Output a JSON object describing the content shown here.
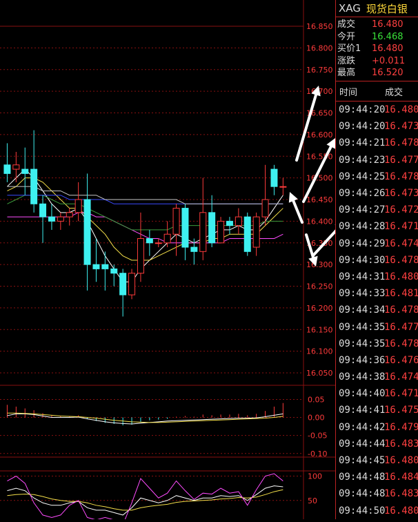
{
  "price_axis": {
    "ticks": [
      "16.850",
      "16.800",
      "16.750",
      "16.700",
      "16.650",
      "16.600",
      "16.550",
      "16.500",
      "16.450",
      "16.400",
      "16.350",
      "16.300",
      "16.250",
      "16.200",
      "16.150",
      "16.100",
      "16.050"
    ],
    "min": 16.05,
    "max": 16.85
  },
  "macd_axis": {
    "ticks": [
      "0.05",
      "0.00",
      "-0.05",
      "-0.10"
    ]
  },
  "kdj_axis": {
    "ticks": [
      "100",
      "50"
    ]
  },
  "colors": {
    "up": "#ff3b3b",
    "down": "#3ef0f0",
    "grid": "#8a1010",
    "ma1": "#ffffff",
    "ma2": "#f5e04a",
    "ma3": "#ff4cff",
    "ma4": "#3c9b3c",
    "ma5": "#3b4bff",
    "ma6": "#c8c8c8"
  },
  "header": {
    "code": "XAG",
    "name": "现货白银"
  },
  "quote": [
    {
      "label": "成交",
      "value": "16.480",
      "color": "red"
    },
    {
      "label": "今开",
      "value": "16.468",
      "color": "green"
    },
    {
      "label": "买价1",
      "value": "16.480",
      "color": "red"
    },
    {
      "label": "涨跌",
      "value": "+0.011",
      "color": "red"
    },
    {
      "label": "最高",
      "value": "16.520",
      "color": "red"
    }
  ],
  "trades_header": {
    "time": "时间",
    "price": "成交"
  },
  "trades": [
    {
      "time": "09:44:20",
      "price": "16.480"
    },
    {
      "time": "09:44:20",
      "price": "16.473"
    },
    {
      "time": "09:44:21",
      "price": "16.478"
    },
    {
      "time": "09:44:23",
      "price": "16.477"
    },
    {
      "time": "09:44:25",
      "price": "16.478"
    },
    {
      "time": "09:44:26",
      "price": "16.473"
    },
    {
      "time": "09:44:27",
      "price": "16.472"
    },
    {
      "time": "09:44:28",
      "price": "16.471"
    },
    {
      "time": "09:44:29",
      "price": "16.474"
    },
    {
      "time": "09:44:30",
      "price": "16.478"
    },
    {
      "time": "09:44:31",
      "price": "16.480"
    },
    {
      "time": "09:44:33",
      "price": "16.481"
    },
    {
      "time": "09:44:34",
      "price": "16.478"
    },
    {
      "time": "09:44:35",
      "price": "16.477"
    },
    {
      "time": "09:44:35",
      "price": "16.478"
    },
    {
      "time": "09:44:36",
      "price": "16.476"
    },
    {
      "time": "09:44:38",
      "price": "16.474"
    },
    {
      "time": "09:44:40",
      "price": "16.471"
    },
    {
      "time": "09:44:41",
      "price": "16.475"
    },
    {
      "time": "09:44:42",
      "price": "16.479"
    },
    {
      "time": "09:44:44",
      "price": "16.483"
    },
    {
      "time": "09:44:45",
      "price": "16.480"
    },
    {
      "time": "09:44:48",
      "price": "16.484"
    },
    {
      "time": "09:44:48",
      "price": "16.483"
    },
    {
      "time": "09:44:50",
      "price": "16.480"
    }
  ],
  "chart_data": {
    "type": "candlestick",
    "title": "",
    "ylim": [
      16.05,
      16.85
    ],
    "candles": [
      {
        "o": 16.53,
        "c": 16.51,
        "h": 16.58,
        "l": 16.49
      },
      {
        "o": 16.52,
        "c": 16.53,
        "h": 16.56,
        "l": 16.49
      },
      {
        "o": 16.52,
        "c": 16.51,
        "h": 16.57,
        "l": 16.46
      },
      {
        "o": 16.52,
        "c": 16.44,
        "h": 16.61,
        "l": 16.42
      },
      {
        "o": 16.44,
        "c": 16.41,
        "h": 16.46,
        "l": 16.35
      },
      {
        "o": 16.41,
        "c": 16.4,
        "h": 16.44,
        "l": 16.38
      },
      {
        "o": 16.4,
        "c": 16.41,
        "h": 16.42,
        "l": 16.38
      },
      {
        "o": 16.41,
        "c": 16.42,
        "h": 16.43,
        "l": 16.39
      },
      {
        "o": 16.42,
        "c": 16.45,
        "h": 16.49,
        "l": 16.4
      },
      {
        "o": 16.45,
        "c": 16.3,
        "h": 16.51,
        "l": 16.24
      },
      {
        "o": 16.3,
        "c": 16.29,
        "h": 16.36,
        "l": 16.26
      },
      {
        "o": 16.3,
        "c": 16.29,
        "h": 16.33,
        "l": 16.24
      },
      {
        "o": 16.29,
        "c": 16.28,
        "h": 16.3,
        "l": 16.25
      },
      {
        "o": 16.28,
        "c": 16.23,
        "h": 16.29,
        "l": 16.18
      },
      {
        "o": 16.23,
        "c": 16.28,
        "h": 16.29,
        "l": 16.22
      },
      {
        "o": 16.28,
        "c": 16.36,
        "h": 16.42,
        "l": 16.26
      },
      {
        "o": 16.36,
        "c": 16.35,
        "h": 16.38,
        "l": 16.32
      },
      {
        "o": 16.35,
        "c": 16.35,
        "h": 16.36,
        "l": 16.34
      },
      {
        "o": 16.35,
        "c": 16.37,
        "h": 16.4,
        "l": 16.34
      },
      {
        "o": 16.37,
        "c": 16.43,
        "h": 16.44,
        "l": 16.32
      },
      {
        "o": 16.43,
        "c": 16.34,
        "h": 16.44,
        "l": 16.31
      },
      {
        "o": 16.34,
        "c": 16.33,
        "h": 16.36,
        "l": 16.3
      },
      {
        "o": 16.33,
        "c": 16.42,
        "h": 16.5,
        "l": 16.31
      },
      {
        "o": 16.42,
        "c": 16.35,
        "h": 16.46,
        "l": 16.34
      },
      {
        "o": 16.35,
        "c": 16.4,
        "h": 16.41,
        "l": 16.35
      },
      {
        "o": 16.4,
        "c": 16.39,
        "h": 16.41,
        "l": 16.37
      },
      {
        "o": 16.39,
        "c": 16.41,
        "h": 16.43,
        "l": 16.37
      },
      {
        "o": 16.41,
        "c": 16.33,
        "h": 16.42,
        "l": 16.32
      },
      {
        "o": 16.34,
        "c": 16.41,
        "h": 16.42,
        "l": 16.32
      },
      {
        "o": 16.41,
        "c": 16.45,
        "h": 16.53,
        "l": 16.39
      },
      {
        "o": 16.52,
        "c": 16.48,
        "h": 16.53,
        "l": 16.46
      },
      {
        "o": 16.48,
        "c": 16.48,
        "h": 16.5,
        "l": 16.46
      }
    ],
    "ma_series": [
      {
        "values": [
          16.48,
          16.5,
          16.52,
          16.5,
          16.47,
          16.44,
          16.42,
          16.42,
          16.43,
          16.4,
          16.36,
          16.32,
          16.29,
          16.26,
          16.26,
          16.29,
          16.31,
          16.33,
          16.35,
          16.37,
          16.36,
          16.35,
          16.36,
          16.37,
          16.38,
          16.38,
          16.39,
          16.38,
          16.38,
          16.4,
          16.43,
          16.46
        ]
      },
      {
        "values": [
          16.47,
          16.48,
          16.5,
          16.5,
          16.49,
          16.47,
          16.45,
          16.43,
          16.43,
          16.41,
          16.39,
          16.37,
          16.34,
          16.32,
          16.31,
          16.31,
          16.31,
          16.32,
          16.33,
          16.34,
          16.35,
          16.35,
          16.35,
          16.36,
          16.36,
          16.37,
          16.37,
          16.37,
          16.37,
          16.39,
          16.41,
          16.43
        ]
      },
      {
        "values": [
          16.41,
          16.41,
          16.41,
          16.41,
          16.41,
          16.41,
          16.41,
          16.41,
          16.42,
          16.42,
          16.41,
          16.41,
          16.4,
          16.39,
          16.38,
          16.37,
          16.36,
          16.36,
          16.35,
          16.35,
          16.35,
          16.35,
          16.35,
          16.35,
          16.35,
          16.36,
          16.36,
          16.36,
          16.36,
          16.36,
          16.36,
          16.37
        ]
      },
      {
        "values": [
          16.44,
          16.45,
          16.46,
          16.46,
          16.46,
          16.45,
          16.44,
          16.44,
          16.44,
          16.43,
          16.42,
          16.41,
          16.4,
          16.39,
          16.38,
          16.38,
          16.38,
          16.38,
          16.38,
          16.39,
          16.39,
          16.39,
          16.39,
          16.39,
          16.39,
          16.39,
          16.39,
          16.39,
          16.39,
          16.4,
          16.4,
          16.4
        ]
      },
      {
        "values": [
          16.46,
          16.46,
          16.46,
          16.46,
          16.46,
          16.46,
          16.46,
          16.45,
          16.45,
          16.45,
          16.45,
          16.45,
          16.44,
          16.44,
          16.44,
          16.44,
          16.44,
          16.44,
          16.44,
          16.44,
          16.44,
          16.44,
          16.44,
          16.44,
          16.44,
          16.44,
          16.44,
          16.44,
          16.44,
          16.44,
          16.44,
          16.44
        ]
      },
      {
        "values": [
          16.48,
          16.48,
          16.48,
          16.48,
          16.47,
          16.47,
          16.47,
          16.46,
          16.46,
          16.46,
          16.46,
          16.45,
          16.45,
          16.45,
          16.45,
          16.45,
          16.45,
          16.45,
          16.45,
          16.45,
          16.44,
          16.44,
          16.44,
          16.44,
          16.44,
          16.44,
          16.44,
          16.44,
          16.44,
          16.44,
          16.44,
          16.44
        ]
      }
    ],
    "macd_hist": [
      0.035,
      0.03,
      0.025,
      0.02,
      0.012,
      0.006,
      0.004,
      0.004,
      0.006,
      -0.004,
      -0.01,
      -0.015,
      -0.018,
      -0.022,
      -0.02,
      -0.012,
      -0.008,
      -0.006,
      -0.004,
      0.002,
      0.004,
      0.002,
      0.008,
      0.006,
      0.008,
      0.008,
      0.01,
      0.006,
      0.01,
      0.018,
      0.03,
      0.04
    ],
    "macd_dif": [
      0.005,
      0.01,
      0.01,
      0.008,
      0.004,
      0.0,
      0.0,
      0.0,
      0.001,
      -0.004,
      -0.008,
      -0.012,
      -0.015,
      -0.017,
      -0.018,
      -0.016,
      -0.014,
      -0.012,
      -0.01,
      -0.009,
      -0.008,
      -0.007,
      -0.006,
      -0.005,
      -0.004,
      -0.003,
      -0.002,
      -0.002,
      -0.001,
      0.002,
      0.006,
      0.01
    ],
    "macd_dea": [
      0.012,
      0.012,
      0.011,
      0.01,
      0.008,
      0.006,
      0.004,
      0.003,
      0.002,
      0.0,
      -0.002,
      -0.005,
      -0.008,
      -0.01,
      -0.012,
      -0.013,
      -0.014,
      -0.014,
      -0.013,
      -0.012,
      -0.011,
      -0.01,
      -0.009,
      -0.008,
      -0.007,
      -0.006,
      -0.005,
      -0.004,
      -0.003,
      -0.002,
      0.0,
      0.003
    ],
    "kdj_k": [
      70,
      75,
      70,
      55,
      45,
      40,
      40,
      45,
      48,
      35,
      30,
      30,
      25,
      20,
      35,
      55,
      50,
      45,
      50,
      60,
      55,
      50,
      55,
      55,
      60,
      58,
      60,
      50,
      62,
      75,
      80,
      78
    ],
    "kdj_d": [
      60,
      62,
      63,
      62,
      58,
      53,
      50,
      48,
      48,
      45,
      40,
      37,
      33,
      30,
      30,
      35,
      38,
      40,
      42,
      46,
      48,
      49,
      50,
      51,
      53,
      54,
      56,
      55,
      57,
      62,
      68,
      72
    ],
    "kdj_j": [
      90,
      100,
      85,
      45,
      20,
      15,
      20,
      40,
      50,
      15,
      10,
      15,
      10,
      0,
      45,
      95,
      75,
      55,
      65,
      90,
      70,
      52,
      65,
      63,
      75,
      65,
      68,
      40,
      72,
      100,
      105,
      90
    ]
  }
}
